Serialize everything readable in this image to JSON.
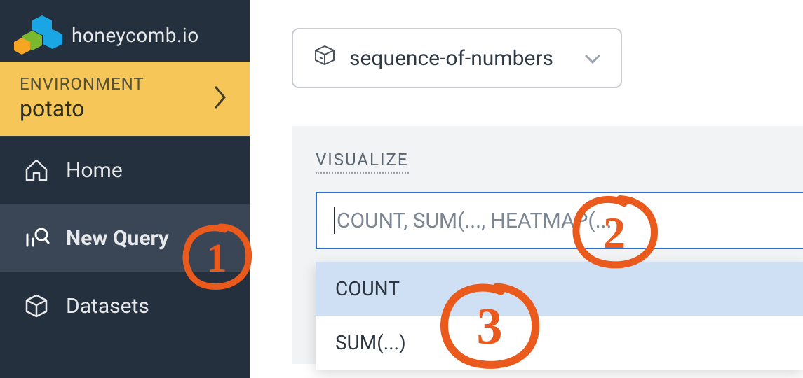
{
  "brand": {
    "name": "honeycomb.io"
  },
  "environment": {
    "label": "ENVIRONMENT",
    "name": "potato"
  },
  "nav": {
    "home": {
      "label": "Home"
    },
    "newquery": {
      "label": "New Query"
    },
    "datasets": {
      "label": "Datasets"
    }
  },
  "dataset_picker": {
    "selected": "sequence-of-numbers"
  },
  "query": {
    "section_label": "VISUALIZE",
    "input_placeholder": "COUNT, SUM(..., HEATMAP(...",
    "dropdown": [
      {
        "label": "COUNT"
      },
      {
        "label": "SUM(...)"
      }
    ]
  },
  "annotations": {
    "a1": "1",
    "a2": "2",
    "a3": "3"
  }
}
